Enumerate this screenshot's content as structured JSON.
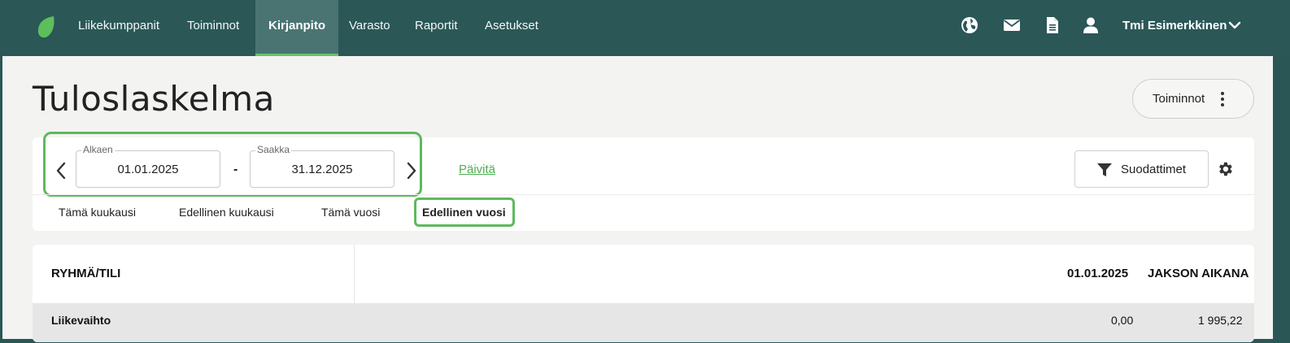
{
  "nav": {
    "items": [
      "Liikekumppanit",
      "Toiminnot",
      "Kirjanpito",
      "Varasto",
      "Raportit",
      "Asetukset"
    ],
    "active": "Kirjanpito",
    "company": "Tmi Esimerkkinen"
  },
  "page": {
    "title": "Tuloslaskelma",
    "actions_label": "Toiminnot"
  },
  "filters": {
    "from_label": "Alkaen",
    "from_value": "01.01.2025",
    "to_label": "Saakka",
    "to_value": "31.12.2025",
    "separator": "-",
    "refresh_label": "Päivitä",
    "filters_button": "Suodattimet",
    "quick_ranges": [
      "Tämä kuukausi",
      "Edellinen kuukausi",
      "Tämä vuosi",
      "Edellinen vuosi"
    ],
    "quick_active": "Edellinen vuosi"
  },
  "table": {
    "headers": [
      "RYHMÄ/TILI",
      "01.01.2025",
      "JAKSON AIKANA"
    ],
    "rows": [
      {
        "name": "Liikevaihto",
        "opening": "0,00",
        "period": "1 995,22"
      }
    ]
  },
  "colors": {
    "topbar": "#2b5757",
    "active_nav": "#4a7472",
    "accent_green": "#5fb95c",
    "link_green": "#4caf50",
    "page_bg": "#f3f3f2"
  },
  "icons": [
    "leaf-logo",
    "globe-icon",
    "mail-icon",
    "document-icon",
    "user-icon",
    "chevron-down-icon",
    "more-vertical-icon",
    "chevron-left-icon",
    "chevron-right-icon",
    "filter-icon",
    "gear-icon"
  ]
}
